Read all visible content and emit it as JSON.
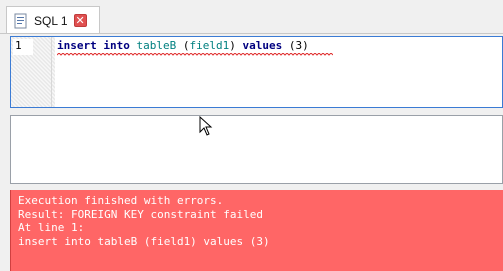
{
  "tab": {
    "label": "SQL 1",
    "icon": "sql-document-icon",
    "close_icon": "close-icon",
    "close_glyph": "✕"
  },
  "editor": {
    "line_number": "1",
    "code_tokens": [
      {
        "text": "insert",
        "kind": "keyword"
      },
      {
        "text": " ",
        "kind": "plain"
      },
      {
        "text": "into",
        "kind": "keyword"
      },
      {
        "text": " ",
        "kind": "plain"
      },
      {
        "text": "tableB",
        "kind": "identifier"
      },
      {
        "text": " (",
        "kind": "plain"
      },
      {
        "text": "field1",
        "kind": "identifier"
      },
      {
        "text": ") ",
        "kind": "plain"
      },
      {
        "text": "values",
        "kind": "keyword"
      },
      {
        "text": " (3)",
        "kind": "plain"
      }
    ]
  },
  "message": {
    "lines": [
      "Execution finished with errors.",
      "Result: FOREIGN KEY constraint failed",
      "At line 1:",
      "insert into tableB (field1) values (3)"
    ]
  },
  "colors": {
    "error_background": "#ff6666",
    "editor_focus_border": "#3b7bd4",
    "keyword": "#000080",
    "identifier": "#008080"
  }
}
